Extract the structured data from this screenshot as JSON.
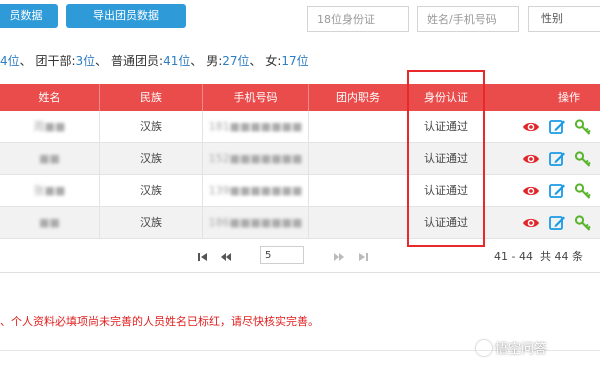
{
  "toolbar": {
    "btn_import_label": "员数据",
    "btn_export_label": "导出团员数据",
    "id18_placeholder": "18位身份证",
    "name_phone_placeholder": "姓名/手机号码",
    "gender_placeholder": "性别"
  },
  "stats": {
    "total": "4位",
    "sep1": "、",
    "cadre_label": "团干部:",
    "cadre_num": "3位",
    "sep2": "、",
    "regular_label": "普通团员:",
    "regular_num": "41位",
    "sep3": "、",
    "male_label": "男:",
    "male_num": "27位",
    "sep4": "、",
    "female_label": "女:",
    "female_num": "17位"
  },
  "table": {
    "headers": {
      "name": "姓名",
      "ethnicity": "民族",
      "phone": "手机号码",
      "role": "团内职务",
      "id_verify": "身份认证",
      "ops": "操作"
    },
    "rows": [
      {
        "name": "周■■",
        "ethnicity": "汉族",
        "phone": "181■■■■■■■",
        "role": "",
        "id_verify": "认证通过"
      },
      {
        "name": "■■",
        "ethnicity": "汉族",
        "phone": "152■■■■■■■",
        "role": "",
        "id_verify": "认证通过"
      },
      {
        "name": "张■■",
        "ethnicity": "汉族",
        "phone": "139■■■■■■■",
        "role": "",
        "id_verify": "认证通过"
      },
      {
        "name": "■■",
        "ethnicity": "汉族",
        "phone": "186■■■■■■■",
        "role": "",
        "id_verify": "认证通过"
      }
    ]
  },
  "pager": {
    "page_value": "5",
    "range": "41 - 44",
    "total": "共 44 条"
  },
  "notice": "、个人资料必填项尚未完善的人员姓名已标红，请尽快核实完善。",
  "watermark": "悟空问答",
  "colors": {
    "button_blue": "#2e9ad8",
    "header_red": "#ea4b4b",
    "highlight_red": "#e8292c",
    "notice_red": "#e02020",
    "stat_blue": "#2e7ec2"
  },
  "icons": [
    "eye-icon",
    "edit-icon",
    "key-icon",
    "first-page-icon",
    "prev-page-icon",
    "next-page-icon",
    "last-page-icon"
  ]
}
